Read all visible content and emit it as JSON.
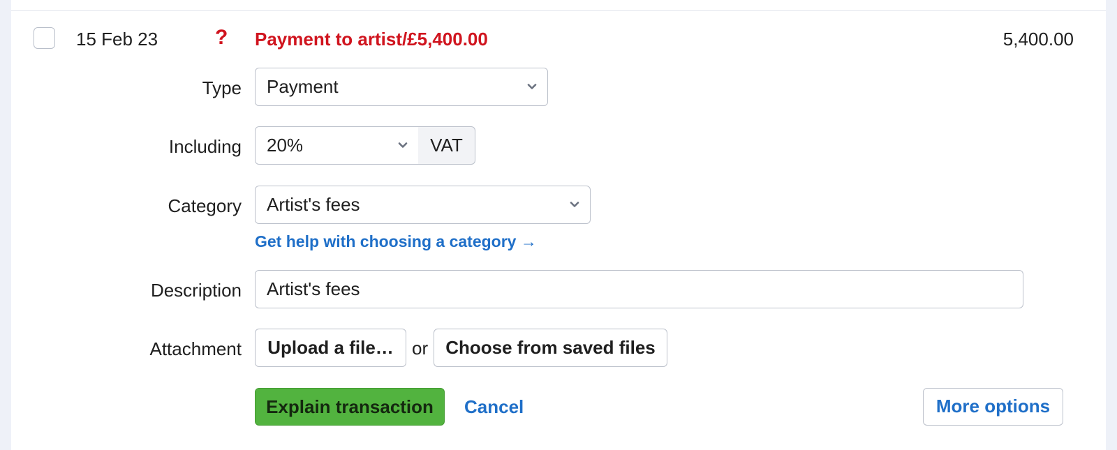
{
  "transaction": {
    "date": "15 Feb 23",
    "status_icon": "?",
    "title": "Payment to artist/£5,400.00",
    "amount": "5,400.00"
  },
  "form": {
    "type": {
      "label": "Type",
      "value": "Payment"
    },
    "including": {
      "label": "Including",
      "value": "20%",
      "addon": "VAT"
    },
    "category": {
      "label": "Category",
      "value": "Artist's fees",
      "help_link": "Get help with choosing a category →"
    },
    "description": {
      "label": "Description",
      "value": "Artist's fees"
    },
    "attachment": {
      "label": "Attachment",
      "upload_button": "Upload a file…",
      "or_text": "or",
      "choose_button": "Choose from saved files"
    }
  },
  "actions": {
    "explain": "Explain transaction",
    "cancel": "Cancel",
    "more_options": "More options"
  },
  "colors": {
    "alert_red": "#d0141e",
    "link_blue": "#1f6fc8",
    "primary_green": "#52b33f",
    "page_bg": "#eef1f8"
  },
  "icons": {
    "status": "question-mark-icon",
    "dropdown": "chevron-down-icon"
  }
}
